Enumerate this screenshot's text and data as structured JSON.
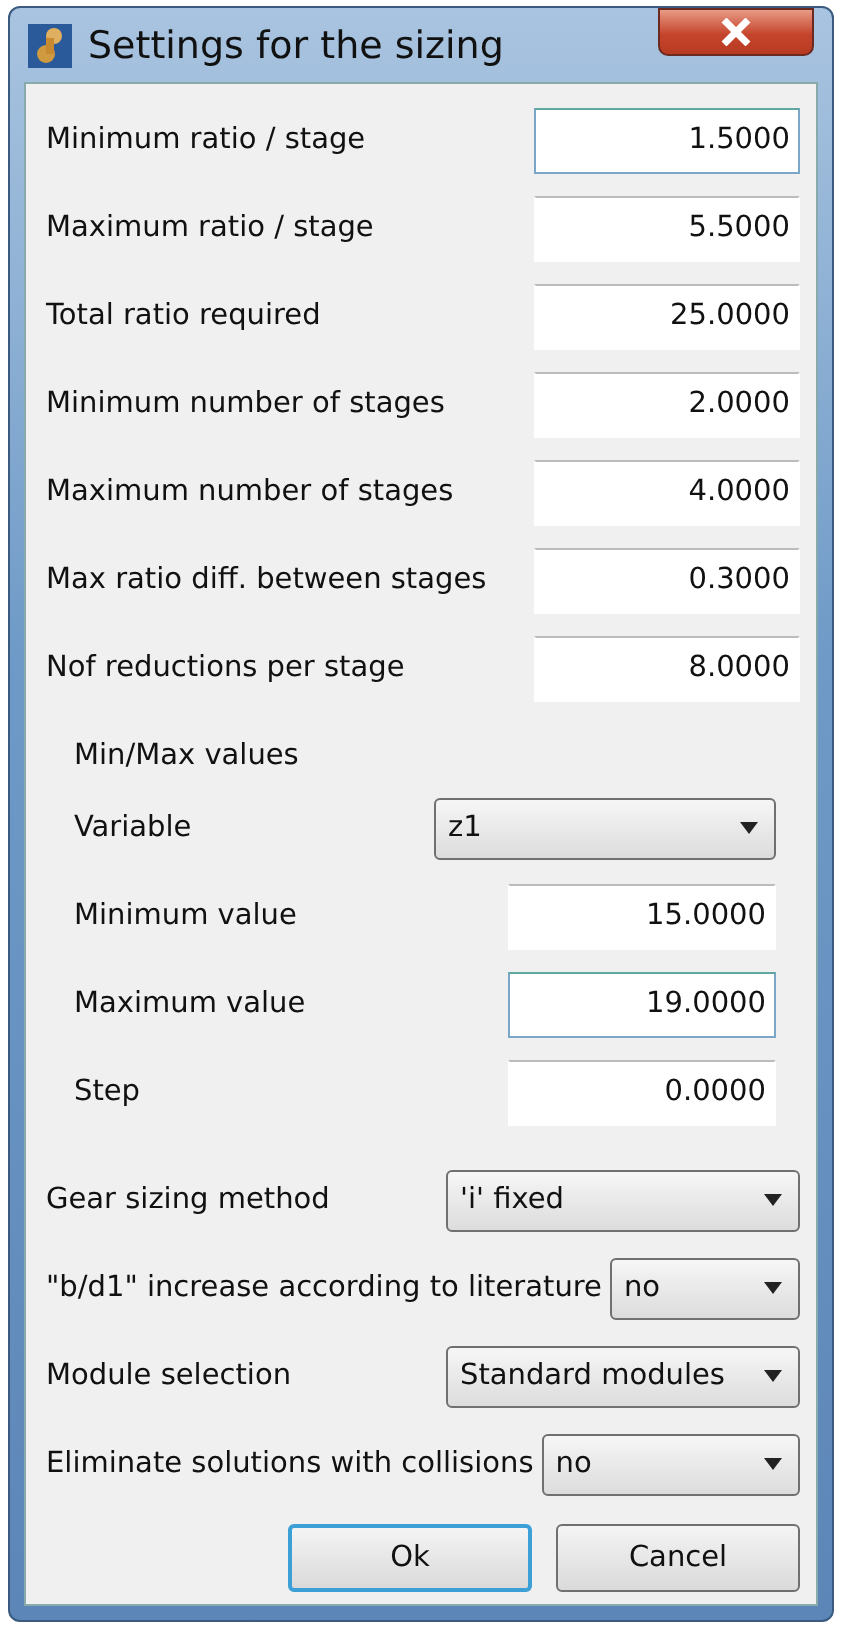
{
  "window": {
    "title": "Settings for the sizing"
  },
  "parameters": [
    {
      "label": "Minimum ratio / stage",
      "value": "1.5000",
      "focused": true
    },
    {
      "label": "Maximum ratio / stage",
      "value": "5.5000",
      "focused": false
    },
    {
      "label": "Total ratio required",
      "value": "25.0000",
      "focused": false
    },
    {
      "label": "Minimum number of stages",
      "value": "2.0000",
      "focused": false
    },
    {
      "label": "Maximum number of stages",
      "value": "4.0000",
      "focused": false
    },
    {
      "label": "Max ratio diff. between stages",
      "value": "0.3000",
      "focused": false
    },
    {
      "label": "Nof reductions per stage",
      "value": "8.0000",
      "focused": false
    }
  ],
  "minmax_group": {
    "title": "Min/Max values",
    "variable": {
      "label": "Variable",
      "value": "z1"
    },
    "fields": [
      {
        "label": "Minimum value",
        "value": "15.0000",
        "focused": false
      },
      {
        "label": "Maximum value",
        "value": "19.0000",
        "focused": true
      },
      {
        "label": "Step",
        "value": "0.0000",
        "focused": false
      }
    ]
  },
  "options": [
    {
      "label": "Gear sizing method",
      "value": "'i' fixed"
    },
    {
      "label": "\"b/d1\" increase according to literature",
      "value": "no"
    },
    {
      "label": "Module selection",
      "value": "Standard modules"
    },
    {
      "label": "Eliminate solutions with collisions",
      "value": "no"
    }
  ],
  "buttons": [
    {
      "label": "Ok",
      "default": true
    },
    {
      "label": "Cancel",
      "default": false
    }
  ]
}
